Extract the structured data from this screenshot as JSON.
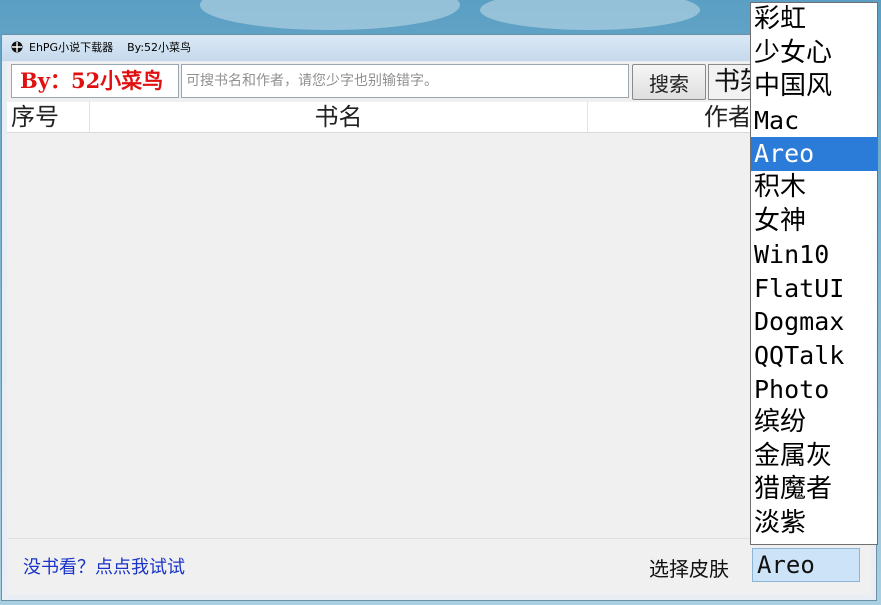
{
  "window": {
    "title": "EhPG小说下载器    By:52小菜鸟"
  },
  "toolbar": {
    "brand_text": "By：52小菜鸟",
    "search_placeholder": "可搜书名和作者，请您少字也别输错字。",
    "search_value": "",
    "search_button": "搜索",
    "shelf_button": "书架"
  },
  "table": {
    "columns": [
      "序号",
      "书名",
      "作者"
    ],
    "rows": []
  },
  "footer": {
    "tip_link": "没书看？点点我试试",
    "skin_label": "选择皮肤",
    "skin_selected": "Areo"
  },
  "skin_dropdown": {
    "selected_index": 4,
    "options": [
      "彩虹",
      "少女心",
      "中国风",
      "Mac",
      "Areo",
      "积木",
      "女神",
      "Win10",
      "FlatUI",
      "Dogmax",
      "QQTalk",
      "Photo",
      "缤纷",
      "金属灰",
      "猎魔者",
      "淡紫"
    ]
  },
  "colors": {
    "brand_red": "#e01010",
    "link_blue": "#1a33c8",
    "selection_blue": "#2b7bd8"
  }
}
